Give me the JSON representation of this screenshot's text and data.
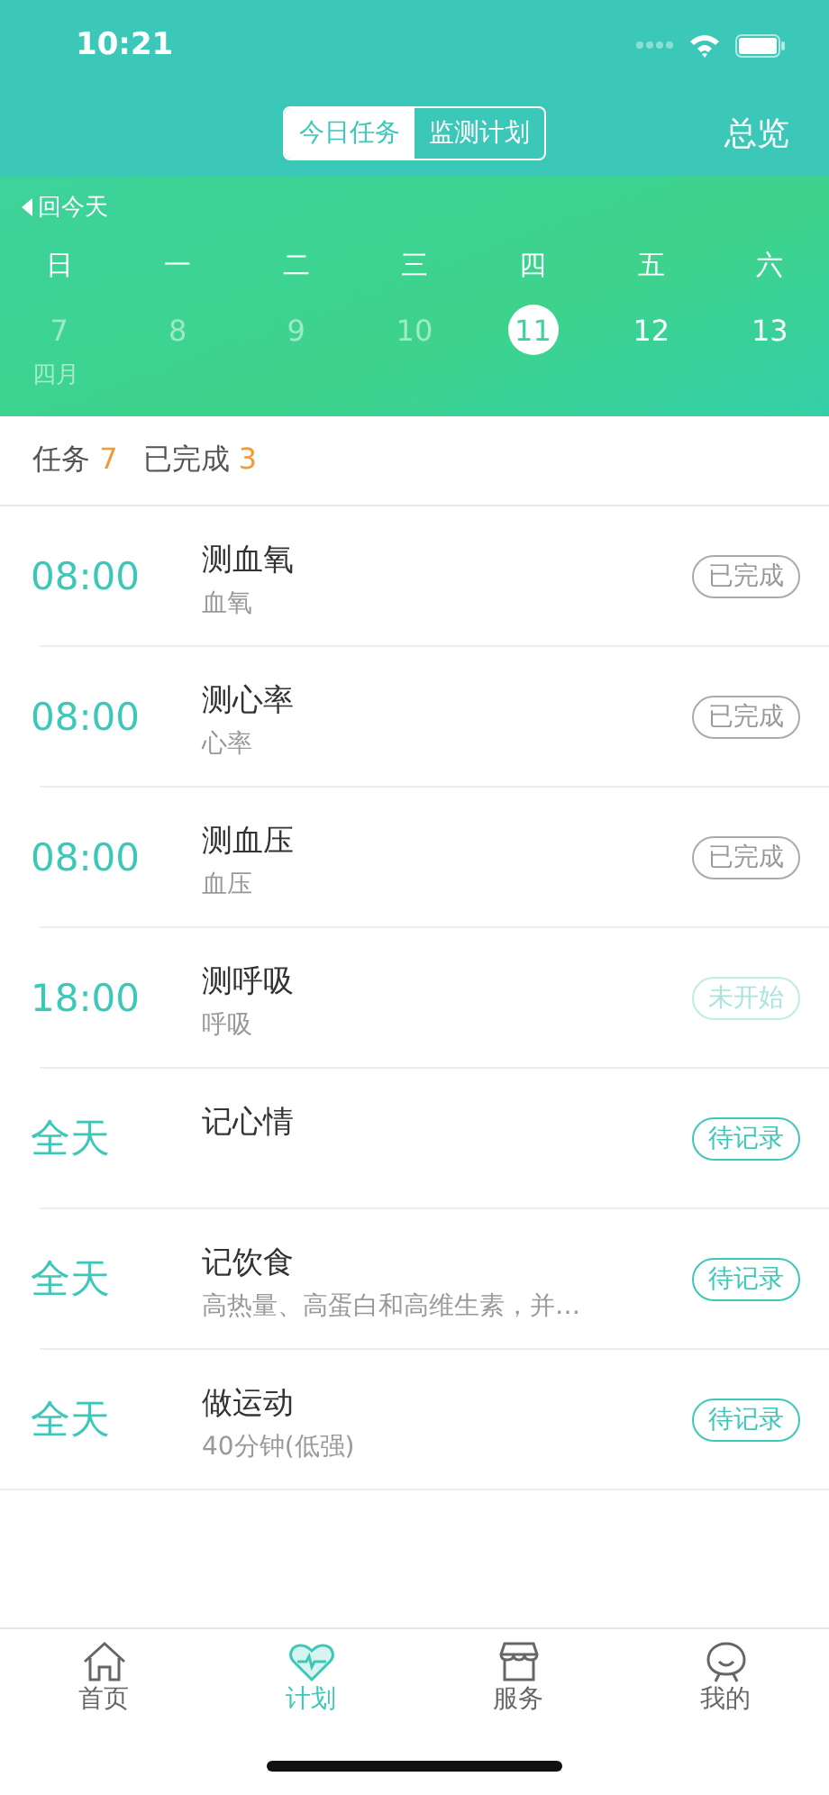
{
  "status_bar": {
    "time": "10:21"
  },
  "header": {
    "segments": [
      {
        "label": "今日任务",
        "selected": true
      },
      {
        "label": "监测计划",
        "selected": false
      }
    ],
    "overview": "总览"
  },
  "calendar": {
    "back_today": "回今天",
    "weekdays": [
      "日",
      "一",
      "二",
      "三",
      "四",
      "五",
      "六"
    ],
    "dates": [
      {
        "day": "7",
        "past": true,
        "selected": false
      },
      {
        "day": "8",
        "past": true,
        "selected": false
      },
      {
        "day": "9",
        "past": true,
        "selected": false
      },
      {
        "day": "10",
        "past": true,
        "selected": false
      },
      {
        "day": "11",
        "past": false,
        "selected": true
      },
      {
        "day": "12",
        "past": false,
        "selected": false
      },
      {
        "day": "13",
        "past": false,
        "selected": false
      }
    ],
    "month": "四月"
  },
  "summary": {
    "tasks_label": "任务",
    "tasks_count": "7",
    "done_label": "已完成",
    "done_count": "3"
  },
  "tasks": [
    {
      "time": "08:00",
      "title": "测血氧",
      "subtitle": "血氧",
      "kind": "done",
      "badge": "已完成"
    },
    {
      "time": "08:00",
      "title": "测心率",
      "subtitle": "心率",
      "kind": "done",
      "badge": "已完成"
    },
    {
      "time": "08:00",
      "title": "测血压",
      "subtitle": "血压",
      "kind": "done",
      "badge": "已完成"
    },
    {
      "time": "18:00",
      "title": "测呼吸",
      "subtitle": "呼吸",
      "kind": "not_started",
      "badge": "未开始"
    },
    {
      "time": "全天",
      "title": "记心情",
      "kind": "pending",
      "badge": "待记录"
    },
    {
      "time": "全天",
      "title": "记饮食",
      "subtitle": "高热量、高蛋白和高维生素，并…",
      "kind": "pending",
      "badge": "待记录"
    },
    {
      "time": "全天",
      "title": "做运动",
      "subtitle": "40分钟(低强)",
      "kind": "pending",
      "badge": "待记录"
    }
  ],
  "tab_bar": [
    {
      "label": "首页",
      "kind": "home",
      "selected": false
    },
    {
      "label": "计划",
      "kind": "heart",
      "selected": true
    },
    {
      "label": "服务",
      "kind": "shop",
      "selected": false
    },
    {
      "label": "我的",
      "kind": "face",
      "selected": false
    }
  ]
}
